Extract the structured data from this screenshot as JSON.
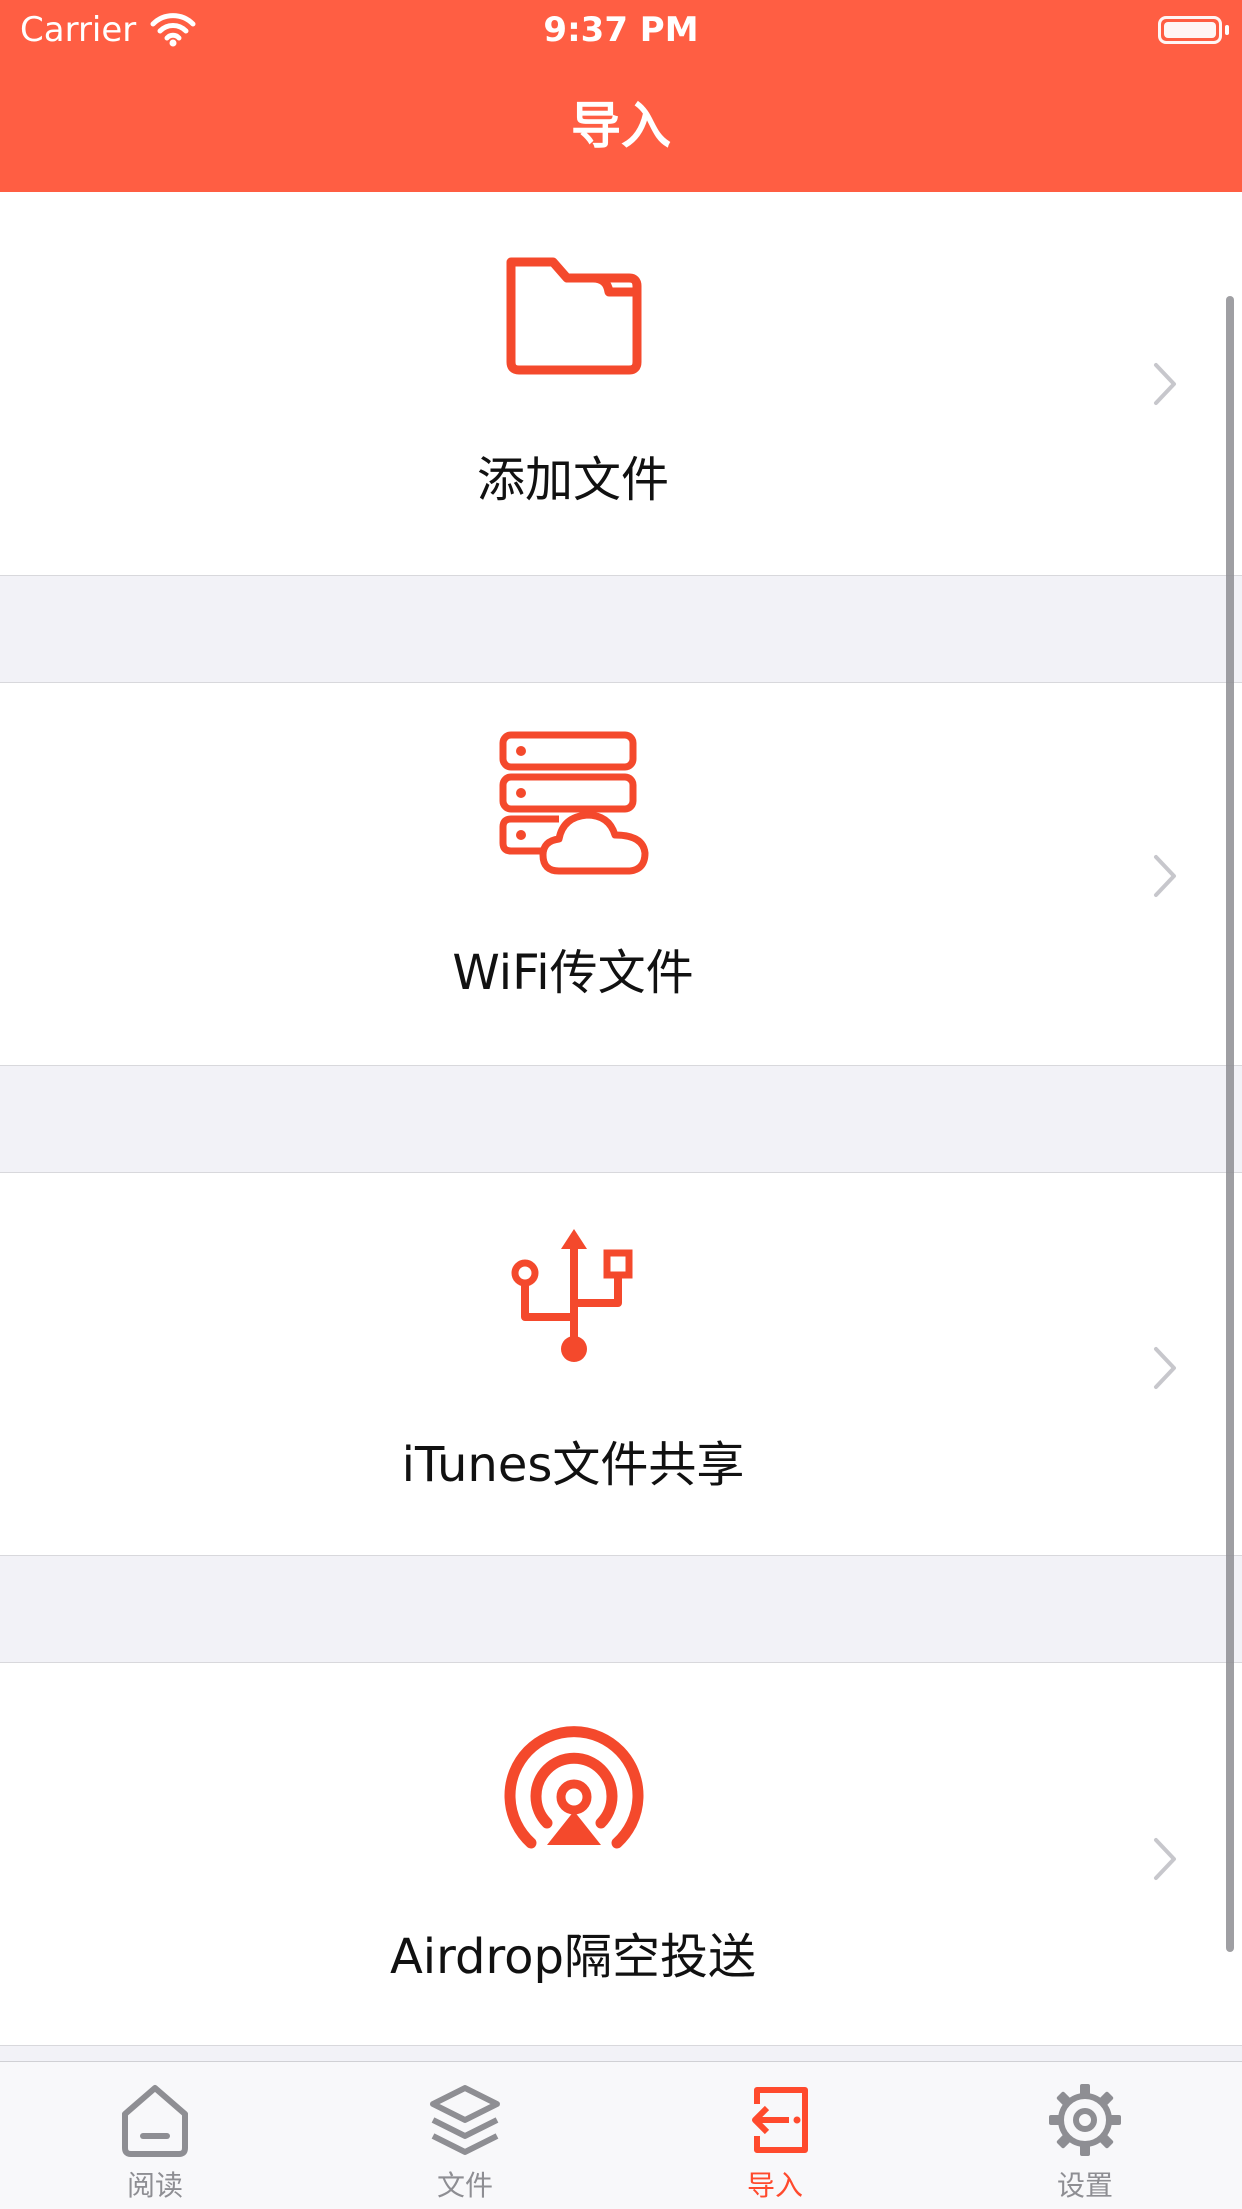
{
  "status_bar": {
    "carrier": "Carrier",
    "time": "9:37 PM"
  },
  "nav": {
    "title": "导入"
  },
  "colors": {
    "accent": "#ff5e43",
    "icon": "#f4492c",
    "tab_inactive": "#8e8e93"
  },
  "rows": [
    {
      "label": "添加文件",
      "icon": "folder-icon"
    },
    {
      "label": "WiFi传文件",
      "icon": "server-cloud-icon"
    },
    {
      "label": "iTunes文件共享",
      "icon": "usb-icon"
    },
    {
      "label": "Airdrop隔空投送",
      "icon": "airdrop-icon"
    }
  ],
  "tabs": [
    {
      "label": "阅读",
      "icon": "home-icon",
      "active": false
    },
    {
      "label": "文件",
      "icon": "layers-icon",
      "active": false
    },
    {
      "label": "导入",
      "icon": "import-icon",
      "active": true
    },
    {
      "label": "设置",
      "icon": "gear-icon",
      "active": false
    }
  ]
}
